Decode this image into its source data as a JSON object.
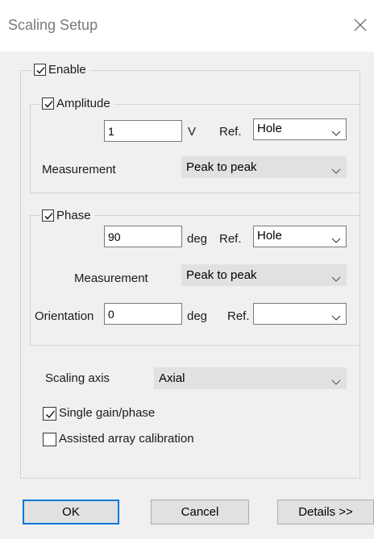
{
  "window": {
    "title": "Scaling Setup"
  },
  "enable": {
    "label": "Enable",
    "checked": true
  },
  "amplitude": {
    "label": "Amplitude",
    "checked": true,
    "value": "1",
    "unit": "V",
    "ref_label": "Ref.",
    "ref_value": "Hole",
    "measurement_label": "Measurement",
    "measurement_value": "Peak to peak"
  },
  "phase": {
    "label": "Phase",
    "checked": true,
    "value": "90",
    "unit": "deg",
    "ref_label": "Ref.",
    "ref_value": "Hole",
    "measurement_label": "Measurement",
    "measurement_value": "Peak to peak",
    "orientation_label": "Orientation",
    "orientation_value": "0",
    "orientation_unit": "deg",
    "orientation_ref_label": "Ref.",
    "orientation_ref_value": ""
  },
  "scaling_axis": {
    "label": "Scaling axis",
    "value": "Axial"
  },
  "single_gain_phase": {
    "label": "Single gain/phase",
    "checked": true
  },
  "assisted_array_calibration": {
    "label": "Assisted array calibration",
    "checked": false
  },
  "buttons": {
    "ok": "OK",
    "cancel": "Cancel",
    "details": "Details >>"
  },
  "icons": {
    "close": "close-icon",
    "checkmark": "checkmark-icon",
    "dropdown": "chevron-down-icon"
  }
}
